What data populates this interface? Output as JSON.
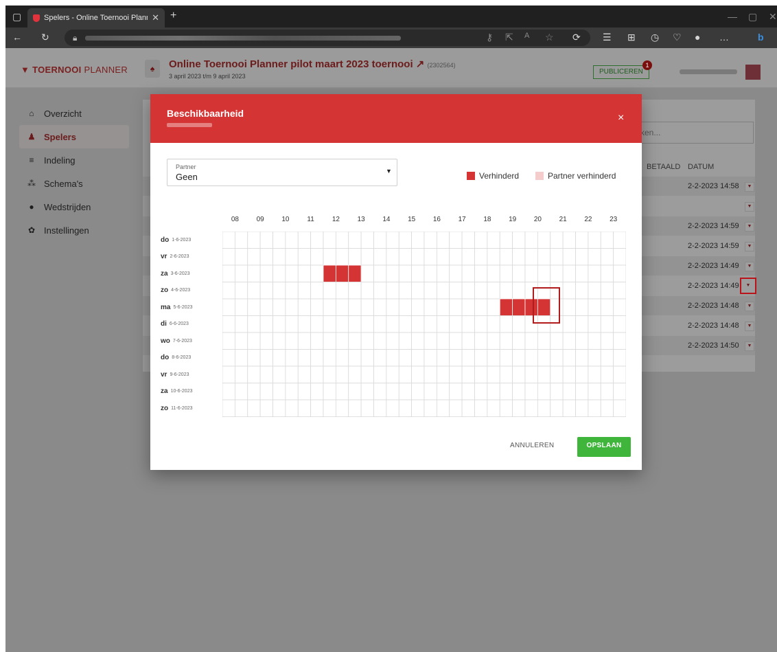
{
  "browser": {
    "tab_title": "Spelers - Online Toernooi Planne",
    "tab_close": "✕",
    "new_tab": "+",
    "toolbar_icons": [
      "back-icon",
      "refresh-icon",
      "lock-icon",
      "key-icon",
      "share-icon",
      "read-aloud-icon",
      "favorite-icon",
      "extensions-icon",
      "favorites-bar-icon",
      "collections-icon",
      "history-icon",
      "heart-icon",
      "profile-icon",
      "more-icon",
      "bing-icon"
    ]
  },
  "app": {
    "logo_bold": "TOERNOOI",
    "logo_thin": "PLANNER",
    "tournament_name": "Online Toernooi Planner pilot maart 2023 toernooi",
    "tournament_id": "(2302564)",
    "tournament_dates": "3 april 2023 t/m 9 april 2023",
    "publish_label": "PUBLICEREN",
    "notification_count": "1"
  },
  "sidebar": {
    "items": [
      {
        "label": "Overzicht",
        "icon": "home-icon",
        "glyph": "⌂",
        "active": false
      },
      {
        "label": "Spelers",
        "icon": "players-icon",
        "glyph": "♟",
        "active": true
      },
      {
        "label": "Indeling",
        "icon": "list-icon",
        "glyph": "≡",
        "active": false
      },
      {
        "label": "Schema's",
        "icon": "sitemap-icon",
        "glyph": "⁂",
        "active": false
      },
      {
        "label": "Wedstrijden",
        "icon": "ball-icon",
        "glyph": "●",
        "active": false
      },
      {
        "label": "Instellingen",
        "icon": "gear-icon",
        "glyph": "✿",
        "active": false
      }
    ]
  },
  "background_table": {
    "search_placeholder": "ken...",
    "col_paid": "BETAALD",
    "col_date": "DATUM",
    "rows": [
      "2-2-2023 14:58",
      "",
      "2-2-2023 14:59",
      "2-2-2023 14:59",
      "2-2-2023 14:49",
      "2-2-2023 14:49",
      "2-2-2023 14:48",
      "2-2-2023 14:48",
      "2-2-2023 14:50"
    ]
  },
  "modal": {
    "title": "Beschikbaarheid",
    "close": "×",
    "partner_label": "Partner",
    "partner_value": "Geen",
    "legend_blocked": "Verhinderd",
    "legend_partner_blocked": "Partner verhinderd",
    "colors": {
      "blocked": "#d53434",
      "partner_blocked": "#f4cccc",
      "header": "#d53434",
      "save": "#3fb53c"
    },
    "hours": [
      "08",
      "09",
      "10",
      "11",
      "12",
      "13",
      "14",
      "15",
      "16",
      "17",
      "18",
      "19",
      "20",
      "21",
      "22",
      "23"
    ],
    "days": [
      {
        "abbr": "do",
        "date": "1-6-2023"
      },
      {
        "abbr": "vr",
        "date": "2-6-2023"
      },
      {
        "abbr": "za",
        "date": "3-6-2023"
      },
      {
        "abbr": "zo",
        "date": "4-6-2023"
      },
      {
        "abbr": "ma",
        "date": "5-6-2023"
      },
      {
        "abbr": "di",
        "date": "6-6-2023"
      },
      {
        "abbr": "wo",
        "date": "7-6-2023"
      },
      {
        "abbr": "do",
        "date": "8-6-2023"
      },
      {
        "abbr": "vr",
        "date": "9-6-2023"
      },
      {
        "abbr": "za",
        "date": "10-6-2023"
      },
      {
        "abbr": "zo",
        "date": "11-6-2023"
      }
    ],
    "slots_per_hour": 2,
    "blocked_slots": [
      {
        "day_index": 2,
        "from_hour": "12",
        "half_hours": 3
      },
      {
        "day_index": 4,
        "from_hour": "19",
        "half_hours": 4
      }
    ],
    "cancel_label": "ANNULEREN",
    "save_label": "OPSLAAN"
  }
}
